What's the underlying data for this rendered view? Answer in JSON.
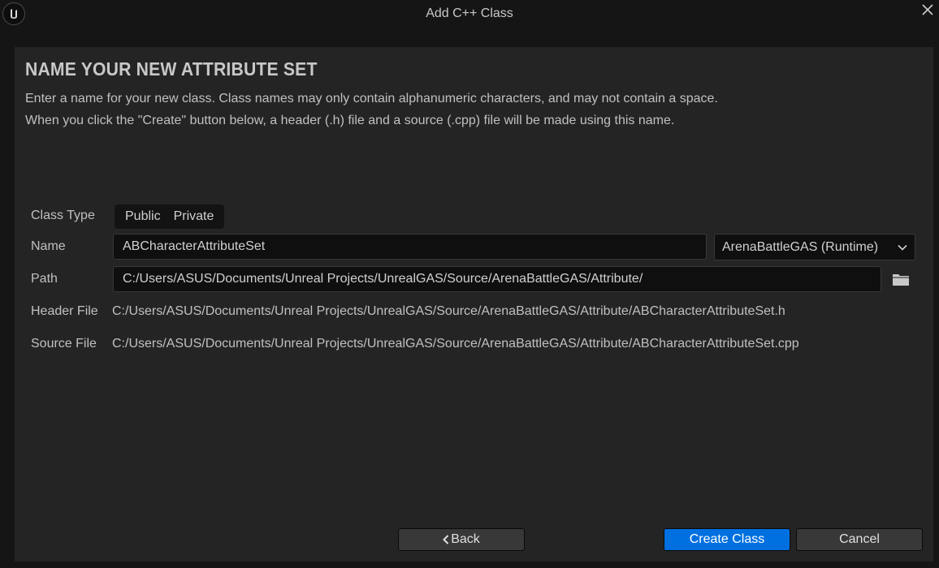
{
  "window": {
    "title": "Add C++ Class",
    "logo_icon": "unreal-engine-logo",
    "close_icon": "close-icon"
  },
  "page": {
    "heading": "NAME YOUR NEW ATTRIBUTE SET",
    "description_line1": "Enter a name for your new class. Class names may only contain alphanumeric characters, and may not contain a space.",
    "description_line2": "When you click the \"Create\" button below, a header (.h) file and a source (.cpp) file will be made using this name."
  },
  "form": {
    "class_type_label": "Class Type",
    "class_type_options": [
      "Public",
      "Private"
    ],
    "name_label": "Name",
    "name_value": "ABCharacterAttributeSet",
    "module_selected": "ArenaBattleGAS (Runtime)",
    "path_label": "Path",
    "path_value": "C:/Users/ASUS/Documents/Unreal Projects/UnrealGAS/Source/ArenaBattleGAS/Attribute/",
    "header_file_label": "Header File",
    "header_file_value": "C:/Users/ASUS/Documents/Unreal Projects/UnrealGAS/Source/ArenaBattleGAS/Attribute/ABCharacterAttributeSet.h",
    "source_file_label": "Source File",
    "source_file_value": "C:/Users/ASUS/Documents/Unreal Projects/UnrealGAS/Source/ArenaBattleGAS/Attribute/ABCharacterAttributeSet.cpp"
  },
  "buttons": {
    "back": "Back",
    "create": "Create Class",
    "cancel": "Cancel"
  },
  "colors": {
    "primary_button": "#0070e0",
    "panel_background": "#242424",
    "window_background": "#151515"
  }
}
